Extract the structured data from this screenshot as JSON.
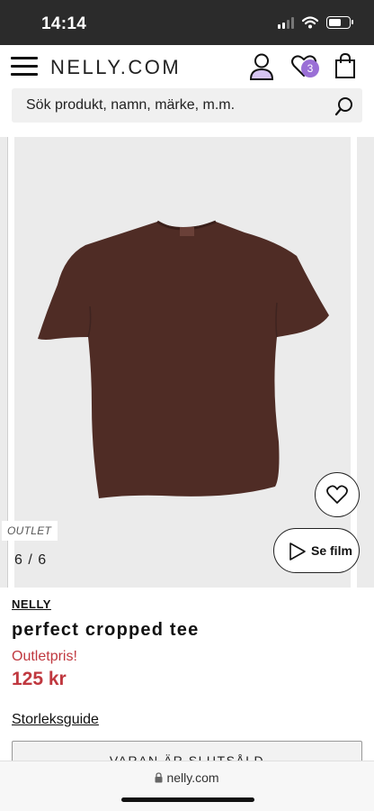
{
  "status_bar": {
    "time": "14:14"
  },
  "header": {
    "logo": "NELLY.COM",
    "wishlist_count": "3",
    "badge_color": "#9a6fd6",
    "icons": [
      "menu-icon",
      "account-icon",
      "wishlist-icon",
      "bag-icon"
    ]
  },
  "search": {
    "placeholder": "Sök produkt, namn, märke, m.m."
  },
  "gallery": {
    "tag": "OUTLET",
    "counter": "6 / 6",
    "film_label": "Se film",
    "product_color": "#4f2c25"
  },
  "product": {
    "brand": "NELLY",
    "name": "perfect cropped tee",
    "price_label": "Outletpris!",
    "price": "125 kr",
    "price_color": "#c0383f",
    "size_guide": "Storleksguide",
    "soldout_label": "VARAN ÄR SLUTSÅLD"
  },
  "browser": {
    "url": "nelly.com"
  }
}
